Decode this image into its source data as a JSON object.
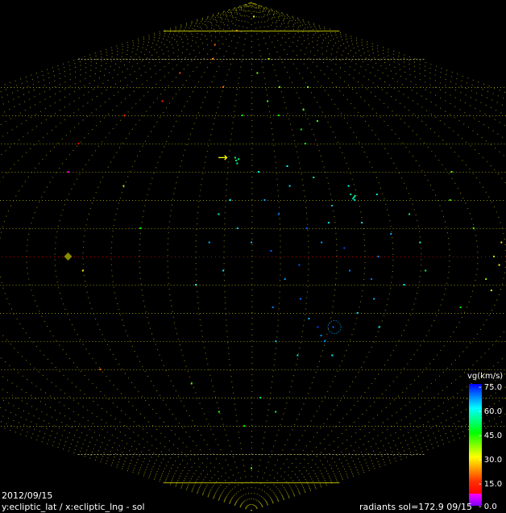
{
  "chart_data": {
    "type": "scatter",
    "projection": "sinusoidal",
    "xlabel": "x:ecliptic_lng - sol",
    "ylabel": "y:ecliptic_lat",
    "axis_caption": "y:ecliptic_lat / x:ecliptic_lng - sol",
    "date": "2012/09/15",
    "info": "radiants sol=172.9 09/15",
    "xlim": [
      -90,
      90
    ],
    "ylim": [
      -90,
      90
    ],
    "grid": true,
    "grid_step_deg": 10,
    "grid_color": "#8a8a00",
    "equator_color": "#b00000",
    "colorbar": {
      "title": "vg(km/s)",
      "ticks": [
        "75.0",
        "60.0",
        "45.0",
        "30.0",
        "15.0",
        "0.0"
      ],
      "range": [
        0,
        75
      ]
    },
    "sun_marker": {
      "lon": -65,
      "lat": 0,
      "color": "#8a8a00"
    },
    "arrow_marker": {
      "glyph": "→",
      "lon": -11,
      "lat": 34,
      "color": "#ffff00"
    },
    "ring_marker": {
      "lon": 32.5,
      "lat": -25,
      "vg": 66
    },
    "points": [
      [
        5,
        20,
        65
      ],
      [
        10,
        15,
        68
      ],
      [
        15,
        25,
        62
      ],
      [
        20,
        10,
        70
      ],
      [
        25,
        5,
        66
      ],
      [
        30,
        18,
        64
      ],
      [
        35,
        -5,
        68
      ],
      [
        40,
        12,
        63
      ],
      [
        45,
        0,
        67
      ],
      [
        50,
        8,
        65
      ],
      [
        55,
        -10,
        62
      ],
      [
        12,
        -8,
        66
      ],
      [
        18,
        -15,
        69
      ],
      [
        22,
        -22,
        64
      ],
      [
        28,
        -28,
        67
      ],
      [
        32,
        -25,
        70
      ],
      [
        26,
        -25,
        72
      ],
      [
        30,
        -30,
        66
      ],
      [
        40,
        -20,
        63
      ],
      [
        45,
        -15,
        65
      ],
      [
        8,
        -18,
        68
      ],
      [
        0,
        5,
        64
      ],
      [
        -5,
        10,
        63
      ],
      [
        -8,
        20,
        60
      ],
      [
        -15,
        5,
        65
      ],
      [
        -10,
        -5,
        62
      ],
      [
        3,
        30,
        58
      ],
      [
        15,
        32,
        60
      ],
      [
        25,
        28,
        55
      ],
      [
        38,
        25,
        60
      ],
      [
        48,
        22,
        58
      ],
      [
        -12,
        15,
        57
      ],
      [
        -20,
        -10,
        60
      ],
      [
        60,
        5,
        55
      ],
      [
        62,
        -5,
        50
      ],
      [
        58,
        15,
        52
      ],
      [
        20,
        -35,
        62
      ],
      [
        35,
        -35,
        60
      ],
      [
        10,
        -30,
        64
      ],
      [
        50,
        -25,
        60
      ],
      [
        28,
        12,
        60
      ],
      [
        33,
        3,
        72
      ],
      [
        7,
        2,
        70
      ],
      [
        17,
        -3,
        71
      ],
      [
        43,
        -8,
        69
      ],
      [
        39,
        21,
        55
      ],
      [
        38.5,
        20.5,
        56
      ],
      [
        39.5,
        21.5,
        54
      ],
      [
        39,
        20,
        57
      ],
      [
        38,
        22,
        55
      ],
      [
        -6.5,
        34,
        52
      ],
      [
        -6,
        33,
        54
      ],
      [
        -7,
        35,
        50
      ],
      [
        -5.5,
        34.5,
        53
      ],
      [
        10,
        55,
        42
      ],
      [
        20,
        60,
        40
      ],
      [
        15,
        50,
        44
      ],
      [
        25,
        45,
        45
      ],
      [
        30,
        52,
        40
      ],
      [
        5,
        65,
        38
      ],
      [
        18,
        70,
        35
      ],
      [
        25,
        40,
        48
      ],
      [
        35,
        48,
        42
      ],
      [
        -5,
        50,
        44
      ],
      [
        40,
        60,
        38
      ],
      [
        -30,
        80,
        25
      ],
      [
        -50,
        75,
        20
      ],
      [
        -60,
        65,
        18
      ],
      [
        -40,
        70,
        22
      ],
      [
        -70,
        50,
        15
      ],
      [
        -80,
        40,
        12
      ],
      [
        -75,
        30,
        8
      ],
      [
        10,
        85,
        30
      ],
      [
        -20,
        60,
        20
      ],
      [
        -55,
        55,
        16
      ],
      [
        88,
        -3,
        30
      ],
      [
        86,
        0,
        35
      ],
      [
        89,
        5,
        28
      ],
      [
        84,
        -8,
        38
      ],
      [
        80,
        10,
        40
      ],
      [
        87,
        -12,
        33
      ],
      [
        75,
        20,
        42
      ],
      [
        78,
        -18,
        45
      ],
      [
        82,
        30,
        40
      ],
      [
        -60,
        -5,
        30
      ],
      [
        -40,
        10,
        45
      ],
      [
        -70,
        -40,
        20
      ],
      [
        -30,
        -45,
        40
      ],
      [
        -20,
        -55,
        42
      ],
      [
        -50,
        25,
        35
      ],
      [
        5,
        -50,
        50
      ],
      [
        15,
        -55,
        48
      ],
      [
        -5,
        -60,
        45
      ],
      [
        0,
        -75,
        40
      ]
    ]
  }
}
